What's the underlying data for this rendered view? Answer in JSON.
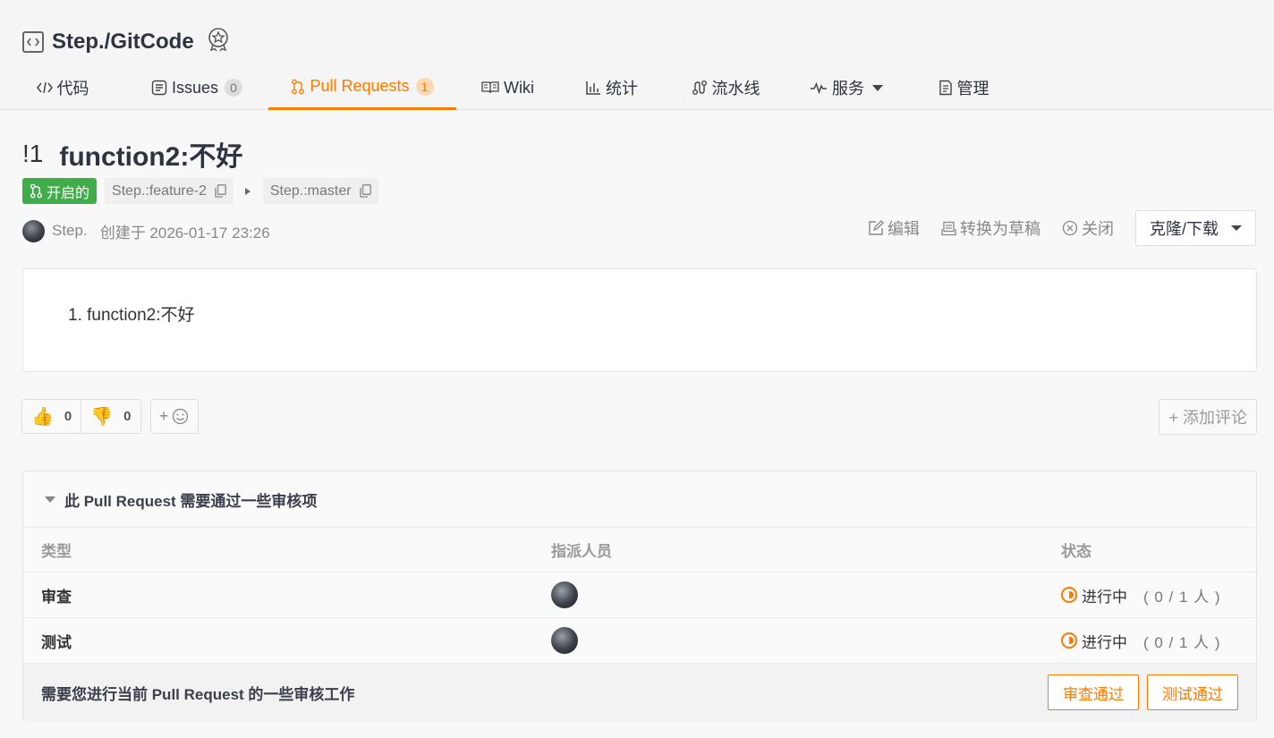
{
  "repo": {
    "name": "Step./GitCode"
  },
  "tabs": [
    {
      "label": "代码",
      "icon": "code-icon"
    },
    {
      "label": "Issues",
      "count": "0",
      "icon": "issues-icon"
    },
    {
      "label": "Pull Requests",
      "count": "1",
      "icon": "pull-request-icon",
      "active": true
    },
    {
      "label": "Wiki",
      "icon": "wiki-icon"
    },
    {
      "label": "统计",
      "icon": "stats-icon"
    },
    {
      "label": "流水线",
      "icon": "pipeline-icon"
    },
    {
      "label": "服务",
      "icon": "pulse-icon"
    },
    {
      "label": "管理",
      "icon": "manage-icon"
    }
  ],
  "pr": {
    "number": "!1",
    "title": "function2:不好",
    "state": "开启的",
    "source_branch": "Step.:feature-2",
    "target_branch": "Step.:master",
    "author": "Step.",
    "created": "创建于 2026-01-17 23:26",
    "description_item": "1. function2:不好"
  },
  "actions": {
    "edit": "编辑",
    "draft": "转换为草稿",
    "close": "关闭",
    "clone": "克隆/下载"
  },
  "reactions": {
    "thumbs_up": "0",
    "thumbs_down": "0",
    "add_emoji": "+",
    "add_comment": "+ 添加评论"
  },
  "review": {
    "heading": "此 Pull Request 需要通过一些审核项",
    "columns": [
      "类型",
      "指派人员",
      "状态"
    ],
    "rows": [
      {
        "type": "审查",
        "status": "进行中",
        "count": "( 0 / 1 人 )"
      },
      {
        "type": "测试",
        "status": "进行中",
        "count": "( 0 / 1 人 )"
      }
    ],
    "footer_msg": "需要您进行当前 Pull Request 的一些审核工作",
    "btn_review": "审查通过",
    "btn_test": "测试通过"
  },
  "colors": {
    "accent": "#ff7b00",
    "open_badge": "#3fad4a"
  }
}
